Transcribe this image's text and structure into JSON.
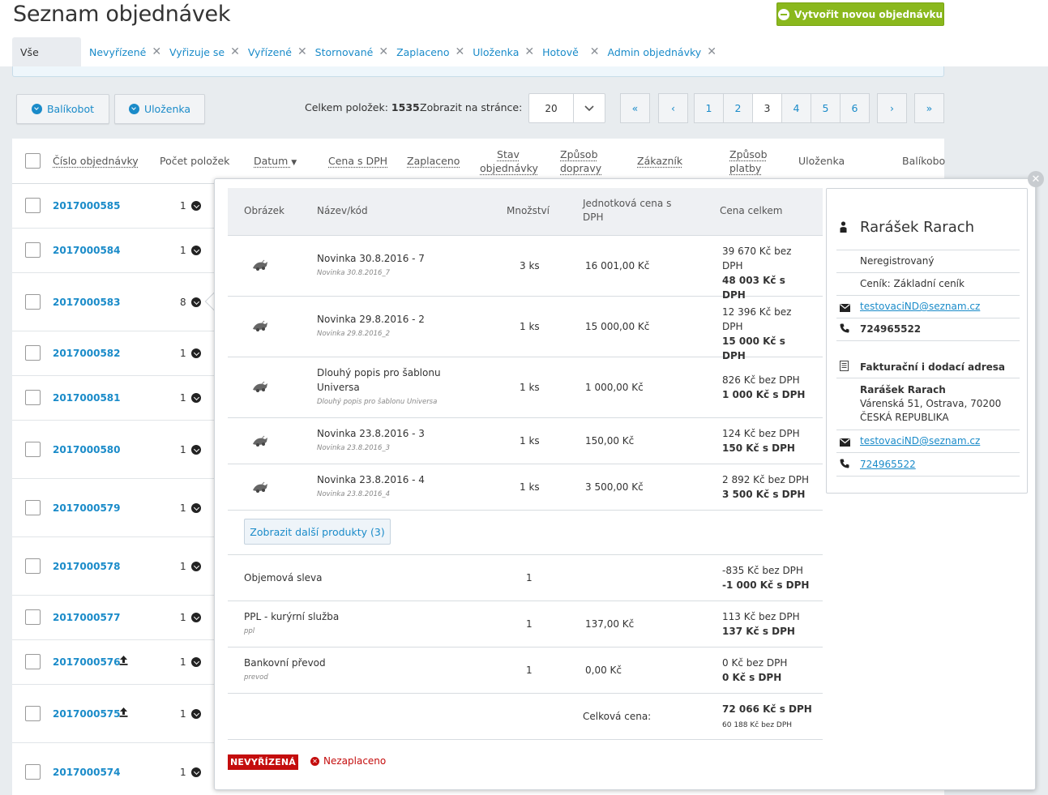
{
  "page_title": "Seznam objednávek",
  "new_order_button": "Vytvořit novou objednávku",
  "tabs": [
    {
      "label": "Vše"
    },
    {
      "label": "Nevyřízené"
    },
    {
      "label": "Vyřizuje se"
    },
    {
      "label": "Vyřízené"
    },
    {
      "label": "Stornované"
    },
    {
      "label": "Zaplaceno"
    },
    {
      "label": "Uloženka"
    },
    {
      "label": "Hotově"
    },
    {
      "label": "Admin objednávky"
    }
  ],
  "toolbar": {
    "balikobot": "Balíkobot",
    "ulozenka": "Uloženka",
    "total_label": "Celkem položek:",
    "total_value": "1535",
    "per_page_label": "Zobrazit na stránce:",
    "per_page_value": "20"
  },
  "pagination": {
    "first": "«",
    "prev": "‹",
    "pages": [
      "1",
      "2",
      "3",
      "4",
      "5",
      "6"
    ],
    "current": "3",
    "next": "›",
    "last": "»"
  },
  "columns": {
    "order_number": "Číslo objednávky",
    "item_count": "Počet položek",
    "date": "Datum",
    "price": "Cena s DPH",
    "paid": "Zaplaceno",
    "status": "Stav objednávky",
    "shipping": "Způsob dopravy",
    "customer": "Zákazník",
    "payment": "Způsob platby",
    "ulozenka": "Uloženka",
    "balikobot": "Balíkobo"
  },
  "orders": [
    {
      "id": "2017000585",
      "count": "1",
      "export": false
    },
    {
      "id": "2017000584",
      "count": "1",
      "export": false
    },
    {
      "id": "2017000583",
      "count": "8",
      "export": false
    },
    {
      "id": "2017000582",
      "count": "1",
      "export": false
    },
    {
      "id": "2017000581",
      "count": "1",
      "export": false
    },
    {
      "id": "2017000580",
      "count": "1",
      "export": false
    },
    {
      "id": "2017000579",
      "count": "1",
      "export": false
    },
    {
      "id": "2017000578",
      "count": "1",
      "export": false
    },
    {
      "id": "2017000577",
      "count": "1",
      "export": false
    },
    {
      "id": "2017000576",
      "count": "1",
      "export": true
    },
    {
      "id": "2017000575",
      "count": "1",
      "export": true
    },
    {
      "id": "2017000574",
      "count": "1",
      "export": false
    }
  ],
  "detail": {
    "headers": {
      "image": "Obrázek",
      "name": "Název/kód",
      "qty": "Množství",
      "unit": "Jednotková cena s DPH",
      "total": "Cena celkem"
    },
    "products": [
      {
        "name": "Novinka 30.8.2016 - 7",
        "code": "Novinka 30.8.2016_7",
        "qty": "3 ks",
        "unit": "16 001,00 Kč",
        "net": "39 670 Kč bez DPH",
        "gross": "48 003 Kč s DPH"
      },
      {
        "name": "Novinka 29.8.2016 - 2",
        "code": "Novinka 29.8.2016_2",
        "qty": "1 ks",
        "unit": "15 000,00 Kč",
        "net": "12 396 Kč bez DPH",
        "gross": "15 000 Kč s DPH"
      },
      {
        "name": "Dlouhý popis pro šablonu Universa",
        "code": "Dlouhý popis pro šablonu Universa",
        "qty": "1 ks",
        "unit": "1 000,00 Kč",
        "net": "826 Kč bez DPH",
        "gross": "1 000 Kč s DPH"
      },
      {
        "name": "Novinka 23.8.2016 - 3",
        "code": "Novinka 23.8.2016_3",
        "qty": "1 ks",
        "unit": "150,00 Kč",
        "net": "124 Kč bez DPH",
        "gross": "150 Kč s DPH"
      },
      {
        "name": "Novinka 23.8.2016 - 4",
        "code": "Novinka 23.8.2016_4",
        "qty": "1 ks",
        "unit": "3 500,00 Kč",
        "net": "2 892 Kč bez DPH",
        "gross": "3 500 Kč s DPH"
      }
    ],
    "more_button": "Zobrazit další produkty (3)",
    "extras": [
      {
        "name": "Objemová sleva",
        "sub": "",
        "qty": "1",
        "unit": "",
        "net": "-835 Kč bez DPH",
        "gross": "-1 000 Kč s DPH"
      },
      {
        "name": "PPL - kurýrní služba",
        "sub": "ppl",
        "qty": "1",
        "unit": "137,00 Kč",
        "net": "113 Kč bez DPH",
        "gross": "137 Kč s DPH"
      },
      {
        "name": "Bankovní převod",
        "sub": "prevod",
        "qty": "1",
        "unit": "0,00 Kč",
        "net": "0 Kč bez DPH",
        "gross": "0 Kč s DPH"
      }
    ],
    "total_label": "Celková cena:",
    "total_gross": "72 066 Kč s DPH",
    "total_net": "60 188 Kč bez DPH",
    "status_badge": "NEVYŘÍZENÁ",
    "payment_status": "Nezaplaceno"
  },
  "customer": {
    "name": "Rarášek Rarach",
    "registration": "Neregistrovaný",
    "pricelist": "Ceník: Základní ceník",
    "email": "testovaciND@seznam.cz",
    "phone": "724965522",
    "address_title": "Fakturační i dodací adresa",
    "address_name": "Rarášek Rarach",
    "address_street": "Várenská 51, Ostrava, 70200",
    "address_country": "ČESKÁ REPUBLIKA",
    "address_email": "testovaciND@seznam.cz",
    "address_phone": "724965522"
  },
  "colors": {
    "accent": "#1a8bc9",
    "new_button": "#8ab81d",
    "danger": "#c40d0d"
  }
}
